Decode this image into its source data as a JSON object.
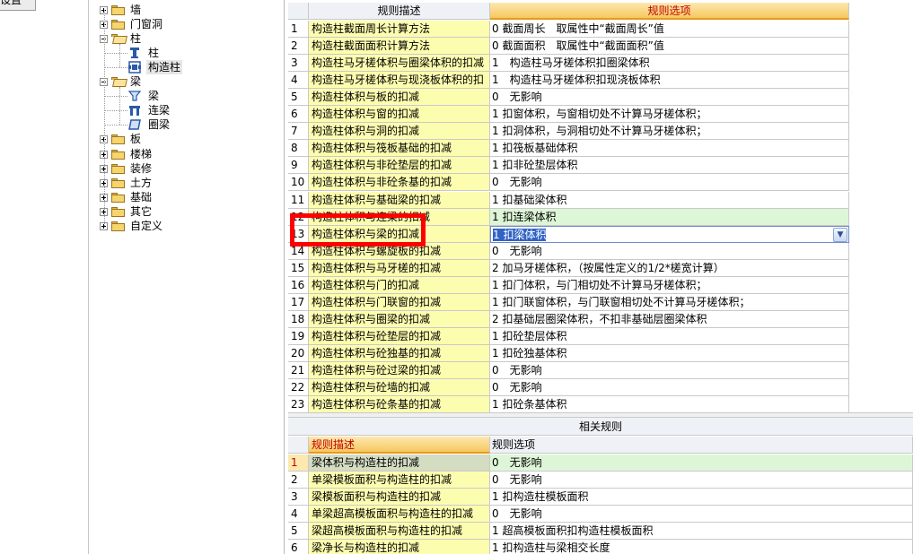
{
  "left_pane": {
    "caption": "设置"
  },
  "tree": [
    {
      "label": "墙",
      "type": "folder",
      "expanded": false,
      "level": 0
    },
    {
      "label": "门窗洞",
      "type": "folder",
      "expanded": false,
      "level": 0
    },
    {
      "label": "柱",
      "type": "folder",
      "expanded": true,
      "level": 0
    },
    {
      "label": "柱",
      "type": "leaf",
      "icon": "column-icon",
      "level": 1
    },
    {
      "label": "构造柱",
      "type": "leaf",
      "icon": "constructional-column-icon",
      "level": 1,
      "selected": true
    },
    {
      "label": "梁",
      "type": "folder",
      "expanded": true,
      "level": 0
    },
    {
      "label": "梁",
      "type": "leaf",
      "icon": "beam-icon",
      "level": 1
    },
    {
      "label": "连梁",
      "type": "leaf",
      "icon": "coupling-beam-icon",
      "level": 1
    },
    {
      "label": "圈梁",
      "type": "leaf",
      "icon": "ring-beam-icon",
      "level": 1
    },
    {
      "label": "板",
      "type": "folder",
      "expanded": false,
      "level": 0
    },
    {
      "label": "楼梯",
      "type": "folder",
      "expanded": false,
      "level": 0
    },
    {
      "label": "装修",
      "type": "folder",
      "expanded": false,
      "level": 0
    },
    {
      "label": "土方",
      "type": "folder",
      "expanded": false,
      "level": 0
    },
    {
      "label": "基础",
      "type": "folder",
      "expanded": false,
      "level": 0
    },
    {
      "label": "其它",
      "type": "folder",
      "expanded": false,
      "level": 0
    },
    {
      "label": "自定义",
      "type": "folder",
      "expanded": false,
      "level": 0
    }
  ],
  "rules_grid": {
    "header": {
      "num": "",
      "desc": "规则描述",
      "opt": "规则选项"
    },
    "rows": [
      {
        "num": "1",
        "desc": "构造柱截面周长计算方法",
        "opt": "0 截面周长　取属性中“截面周长”值"
      },
      {
        "num": "2",
        "desc": "构造柱截面面积计算方法",
        "opt": "0 截面面积　取属性中“截面面积”值"
      },
      {
        "num": "3",
        "desc": "构造柱马牙槎体积与圈梁体积的扣减",
        "opt": "1　构造柱马牙槎体积扣圈梁体积"
      },
      {
        "num": "4",
        "desc": "构造柱马牙槎体积与现浇板体积的扣",
        "opt": "1　构造柱马牙槎体积扣现浇板体积"
      },
      {
        "num": "5",
        "desc": "构造柱体积与板的扣减",
        "opt": "0　无影响"
      },
      {
        "num": "6",
        "desc": "构造柱体积与窗的扣减",
        "opt": "1 扣窗体积，与窗相切处不计算马牙槎体积；"
      },
      {
        "num": "7",
        "desc": "构造柱体积与洞的扣减",
        "opt": "1 扣洞体积，与洞相切处不计算马牙槎体积；"
      },
      {
        "num": "8",
        "desc": "构造柱体积与筏板基础的扣减",
        "opt": "1 扣筏板基础体积"
      },
      {
        "num": "9",
        "desc": "构造柱体积与非砼垫层的扣减",
        "opt": "1 扣非砼垫层体积"
      },
      {
        "num": "10",
        "desc": "构造柱体积与非砼条基的扣减",
        "opt": "0　无影响"
      },
      {
        "num": "11",
        "desc": "构造柱体积与基础梁的扣减",
        "opt": "1 扣基础梁体积"
      },
      {
        "num": "12",
        "desc": "构造柱体积与连梁的扣减",
        "opt": "1 扣连梁体积"
      },
      {
        "num": "13",
        "desc": "构造柱体积与梁的扣减",
        "opt": "1 扣梁体积"
      },
      {
        "num": "14",
        "desc": "构造柱体积与螺旋板的扣减",
        "opt": "0　无影响"
      },
      {
        "num": "15",
        "desc": "构造柱体积与马牙槎的扣减",
        "opt": "2 加马牙槎体积，（按属性定义的1/2*槎宽计算）"
      },
      {
        "num": "16",
        "desc": "构造柱体积与门的扣减",
        "opt": "1 扣门体积，与门相切处不计算马牙槎体积；"
      },
      {
        "num": "17",
        "desc": "构造柱体积与门联窗的扣减",
        "opt": "1 扣门联窗体积，与门联窗相切处不计算马牙槎体积；"
      },
      {
        "num": "18",
        "desc": "构造柱体积与圈梁的扣减",
        "opt": "2 扣基础层圈梁体积，不扣非基础层圈梁体积"
      },
      {
        "num": "19",
        "desc": "构造柱体积与砼垫层的扣减",
        "opt": "1 扣砼垫层体积"
      },
      {
        "num": "20",
        "desc": "构造柱体积与砼独基的扣减",
        "opt": "1 扣砼独基体积"
      },
      {
        "num": "21",
        "desc": "构造柱体积与砼过梁的扣减",
        "opt": "0　无影响"
      },
      {
        "num": "22",
        "desc": "构造柱体积与砼墙的扣减",
        "opt": "0　无影响"
      },
      {
        "num": "23",
        "desc": "构造柱体积与砼条基的扣减",
        "opt": "1 扣砼条基体积"
      }
    ]
  },
  "related_grid": {
    "title": "相关规则",
    "header": {
      "num": "",
      "desc": "规则描述",
      "opt": "规则选项"
    },
    "rows": [
      {
        "num": "1",
        "desc": "梁体积与构造柱的扣减",
        "opt": "0　无影响"
      },
      {
        "num": "2",
        "desc": "单梁模板面积与构造柱的扣减",
        "opt": "0　无影响"
      },
      {
        "num": "3",
        "desc": "梁模板面积与构造柱的扣减",
        "opt": "1 扣构造柱模板面积"
      },
      {
        "num": "4",
        "desc": "单梁超高模板面积与构造柱的扣减",
        "opt": "0　无影响"
      },
      {
        "num": "5",
        "desc": "梁超高模板面积与构造柱的扣减",
        "opt": "1 超高模板面积扣构造柱模板面积"
      },
      {
        "num": "6",
        "desc": "梁净长与构造柱的扣减",
        "opt": "1 扣构造柱与梁相交长度"
      }
    ]
  },
  "colors": {
    "accent_header": "#f7c760",
    "desc_column": "#fdfdb0",
    "highlight_green": "#def6d8",
    "selection": "#3163c5",
    "annotation_box": "#ff0000"
  }
}
